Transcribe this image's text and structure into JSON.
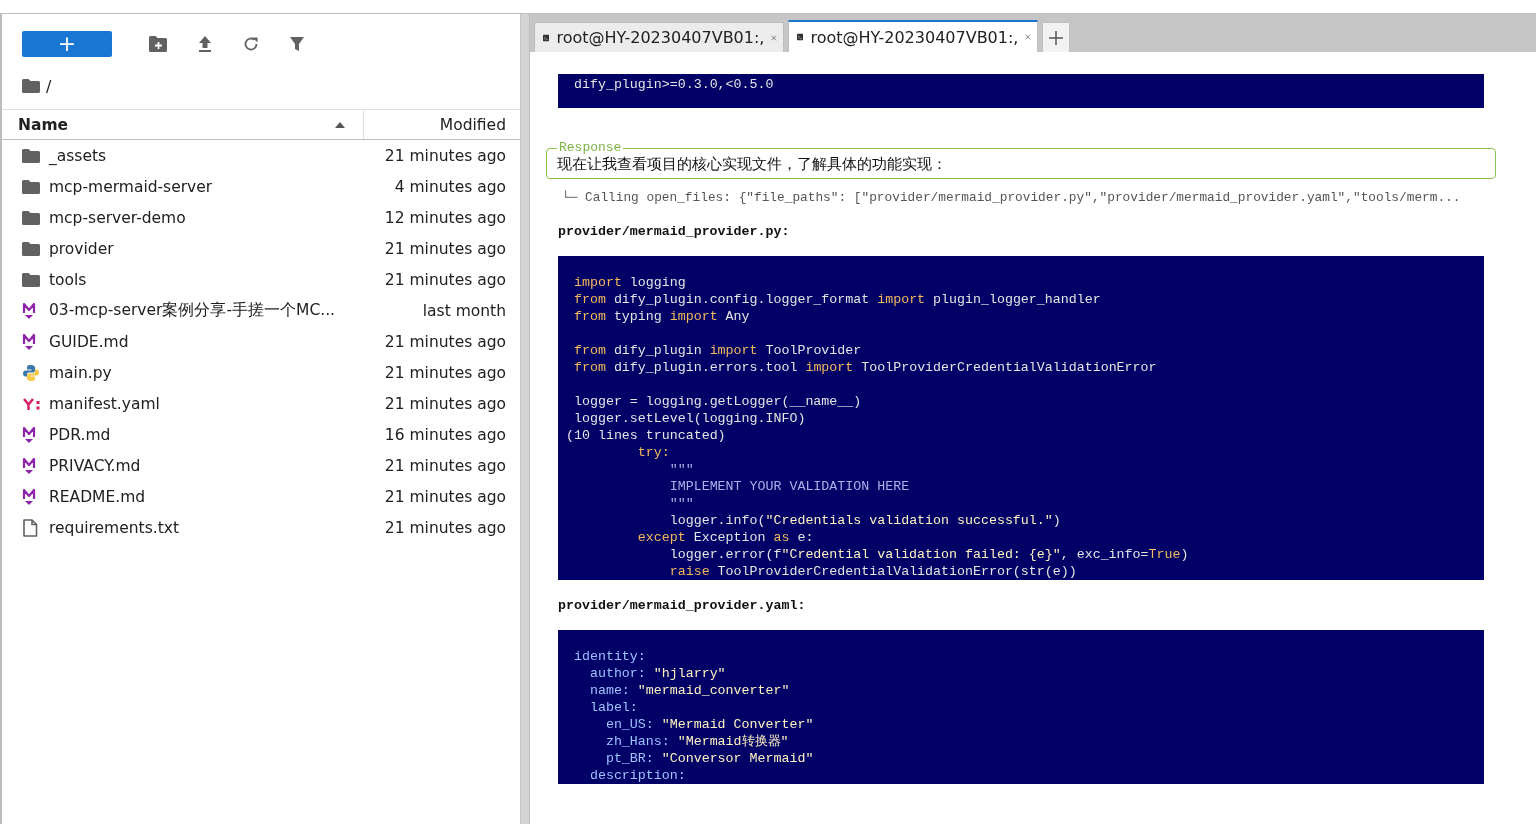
{
  "file_browser": {
    "new_button": "+",
    "breadcrumb": "/",
    "columns": [
      {
        "label": "Name",
        "sorted": true,
        "ascending": true
      },
      {
        "label": "Modified",
        "sorted": false
      }
    ],
    "rows": [
      {
        "kind": "folder",
        "name": "_assets",
        "modified": "21 minutes ago"
      },
      {
        "kind": "folder",
        "name": "mcp-mermaid-server",
        "modified": "4 minutes ago"
      },
      {
        "kind": "folder",
        "name": "mcp-server-demo",
        "modified": "12 minutes ago"
      },
      {
        "kind": "folder",
        "name": "provider",
        "modified": "21 minutes ago"
      },
      {
        "kind": "folder",
        "name": "tools",
        "modified": "21 minutes ago"
      },
      {
        "kind": "markdown",
        "name": "03-mcp-server案例分享-手搓一个MC...",
        "modified": "last month"
      },
      {
        "kind": "markdown",
        "name": "GUIDE.md",
        "modified": "21 minutes ago"
      },
      {
        "kind": "python",
        "name": "main.py",
        "modified": "21 minutes ago"
      },
      {
        "kind": "yaml",
        "name": "manifest.yaml",
        "modified": "21 minutes ago"
      },
      {
        "kind": "markdown",
        "name": "PDR.md",
        "modified": "16 minutes ago"
      },
      {
        "kind": "markdown",
        "name": "PRIVACY.md",
        "modified": "21 minutes ago"
      },
      {
        "kind": "markdown",
        "name": "README.md",
        "modified": "21 minutes ago"
      },
      {
        "kind": "text",
        "name": "requirements.txt",
        "modified": "21 minutes ago"
      }
    ]
  },
  "tabs": [
    {
      "label": "root@HY-20230407VB01:,",
      "selected": false
    },
    {
      "label": "root@HY-20230407VB01:,",
      "selected": true
    }
  ],
  "terminal": [
    {
      "kind": "code",
      "lines": [
        [
          {
            "kind": "plain",
            "text": " dify_plugin>=0.3.0,<0.5.0"
          }
        ]
      ]
    },
    {
      "kind": "response",
      "legend": "Response",
      "text": "现在让我查看项目的核心实现文件，了解具体的功能实现："
    },
    {
      "kind": "call",
      "text": "└─ Calling open_files: {\"file_paths\": [\"provider/mermaid_provider.py\",\"provider/mermaid_provider.yaml\",\"tools/merm..."
    },
    {
      "kind": "heading",
      "text": "provider/mermaid_provider.py:"
    },
    {
      "kind": "code",
      "lines": [
        [
          {
            "kind": "keyword",
            "text": " import"
          },
          {
            "kind": "plain",
            "text": " logging"
          }
        ],
        [
          {
            "kind": "keyword",
            "text": " from"
          },
          {
            "kind": "plain",
            "text": " dify_plugin.config.logger_format "
          },
          {
            "kind": "keyword",
            "text": "import"
          },
          {
            "kind": "plain",
            "text": " plugin_logger_handler"
          }
        ],
        [
          {
            "kind": "keyword",
            "text": " from"
          },
          {
            "kind": "plain",
            "text": " typing "
          },
          {
            "kind": "keyword",
            "text": "import"
          },
          {
            "kind": "plain",
            "text": " Any"
          }
        ],
        [
          {
            "kind": "blank"
          }
        ],
        [
          {
            "kind": "keyword",
            "text": " from"
          },
          {
            "kind": "plain",
            "text": " dify_plugin "
          },
          {
            "kind": "keyword",
            "text": "import"
          },
          {
            "kind": "plain",
            "text": " ToolProvider"
          }
        ],
        [
          {
            "kind": "keyword",
            "text": " from"
          },
          {
            "kind": "plain",
            "text": " dify_plugin.errors.tool "
          },
          {
            "kind": "keyword",
            "text": "import"
          },
          {
            "kind": "plain",
            "text": " ToolProviderCredentialValidationError"
          }
        ],
        [
          {
            "kind": "blank"
          }
        ],
        [
          {
            "kind": "plain",
            "text": " logger = logging.getLogger(__name__)"
          }
        ],
        [
          {
            "kind": "plain",
            "text": " logger.setLevel(logging.INFO)"
          }
        ],
        [
          {
            "kind": "plain",
            "text": "(10 lines truncated)"
          }
        ],
        [
          {
            "kind": "keyword",
            "text": "         try:"
          }
        ],
        [
          {
            "kind": "comment",
            "text": "             \"\"\""
          }
        ],
        [
          {
            "kind": "comment",
            "text": "             IMPLEMENT YOUR VALIDATION HERE"
          }
        ],
        [
          {
            "kind": "comment",
            "text": "             \"\"\""
          }
        ],
        [
          {
            "kind": "plain",
            "text": "             logger.info("
          },
          {
            "kind": "string",
            "text": "\"Credentials validation successful.\""
          },
          {
            "kind": "plain",
            "text": ")"
          }
        ],
        [
          {
            "kind": "keyword",
            "text": "         except"
          },
          {
            "kind": "plain",
            "text": " Exception "
          },
          {
            "kind": "keyword",
            "text": "as"
          },
          {
            "kind": "plain",
            "text": " e:"
          }
        ],
        [
          {
            "kind": "plain",
            "text": "             logger.error(f"
          },
          {
            "kind": "string",
            "text": "\"Credential validation failed: {e}\""
          },
          {
            "kind": "plain",
            "text": ", exc_info="
          },
          {
            "kind": "keyword",
            "text": "True"
          },
          {
            "kind": "plain",
            "text": ")"
          }
        ],
        [
          {
            "kind": "keyword",
            "text": "             raise"
          },
          {
            "kind": "plain",
            "text": " ToolProviderCredentialValidationError(str(e))"
          }
        ]
      ]
    },
    {
      "kind": "heading",
      "text": "provider/mermaid_provider.yaml:"
    },
    {
      "kind": "code",
      "lines": [
        [
          {
            "kind": "key",
            "text": " identity:"
          }
        ],
        [
          {
            "kind": "key",
            "text": "   author:"
          },
          {
            "kind": "string",
            "text": " \"hjlarry\""
          }
        ],
        [
          {
            "kind": "key",
            "text": "   name:"
          },
          {
            "kind": "string",
            "text": " \"mermaid_converter\""
          }
        ],
        [
          {
            "kind": "key",
            "text": "   label:"
          }
        ],
        [
          {
            "kind": "key",
            "text": "     en_US:"
          },
          {
            "kind": "string",
            "text": " \"Mermaid Converter\""
          }
        ],
        [
          {
            "kind": "key",
            "text": "     zh_Hans:"
          },
          {
            "kind": "string",
            "text": " \"Mermaid转换器\""
          }
        ],
        [
          {
            "kind": "key",
            "text": "     pt_BR:"
          },
          {
            "kind": "string",
            "text": " \"Conversor Mermaid\""
          }
        ],
        [
          {
            "kind": "key",
            "text": "   description:"
          }
        ]
      ]
    }
  ]
}
